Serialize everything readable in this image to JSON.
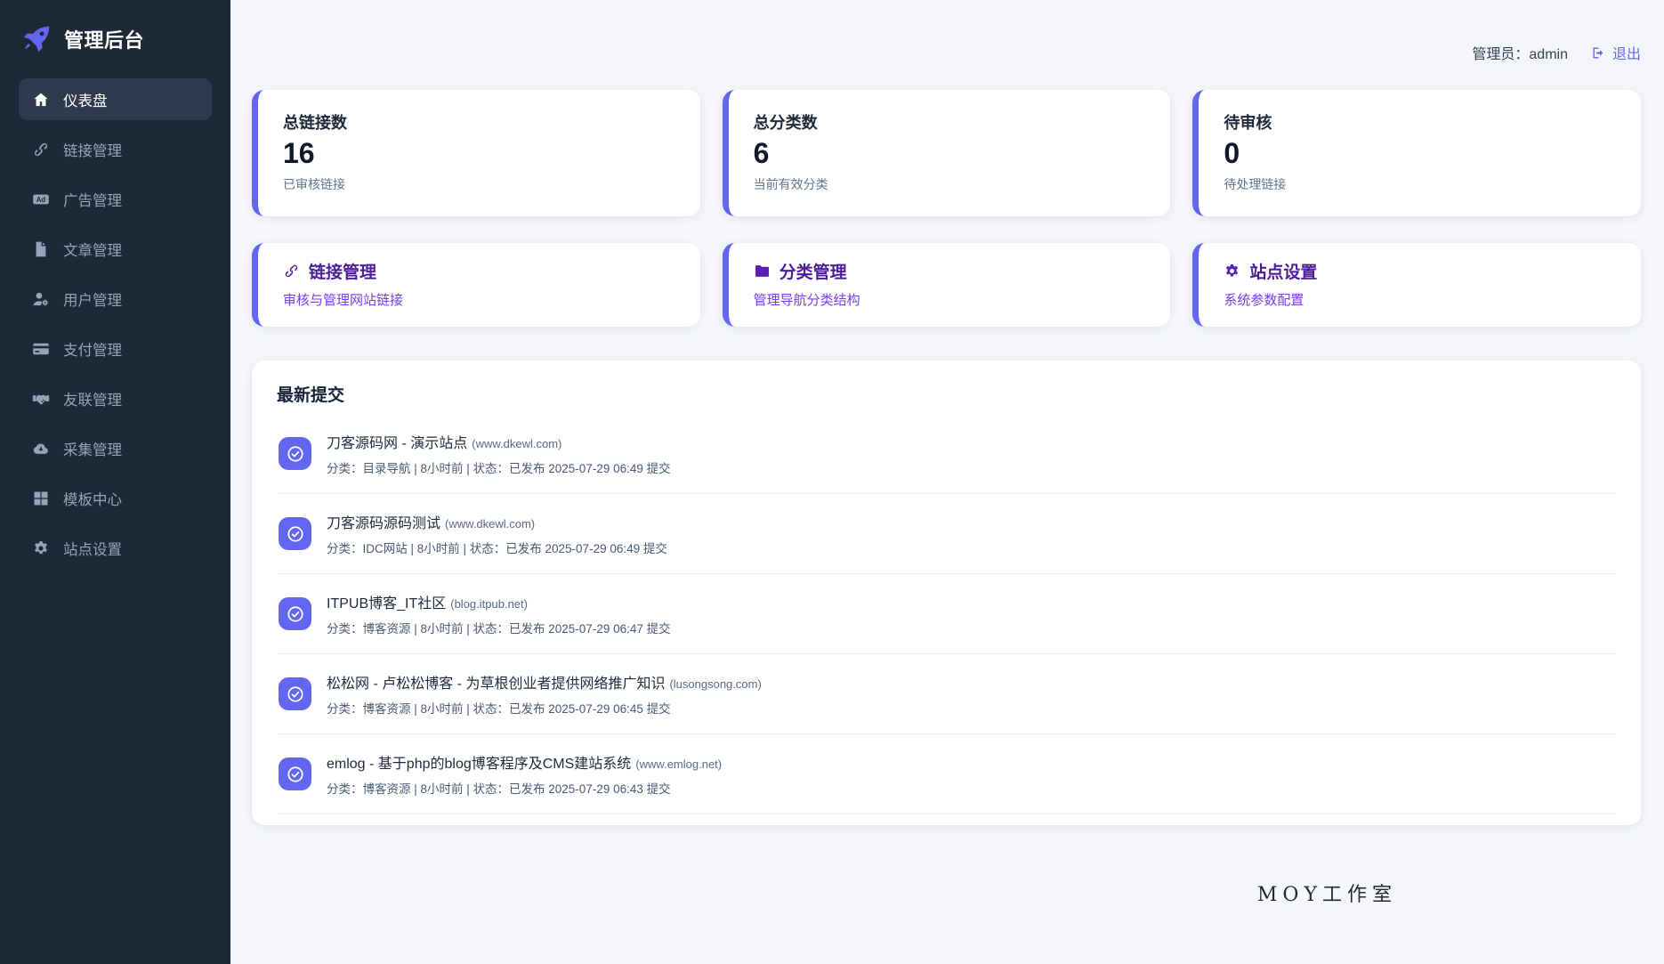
{
  "app": {
    "title": "管理后台",
    "logo_icon": "rocket"
  },
  "header": {
    "admin_label": "管理员：",
    "admin_name": "admin",
    "logout_label": "退出",
    "logout_icon": "logout"
  },
  "sidebar": {
    "items": [
      {
        "label": "仪表盘",
        "icon": "home",
        "active": true
      },
      {
        "label": "链接管理",
        "icon": "link",
        "active": false
      },
      {
        "label": "广告管理",
        "icon": "ad",
        "active": false
      },
      {
        "label": "文章管理",
        "icon": "file",
        "active": false
      },
      {
        "label": "用户管理",
        "icon": "user",
        "active": false
      },
      {
        "label": "支付管理",
        "icon": "card",
        "active": false
      },
      {
        "label": "友联管理",
        "icon": "handshake",
        "active": false
      },
      {
        "label": "采集管理",
        "icon": "cloud",
        "active": false
      },
      {
        "label": "模板中心",
        "icon": "grid",
        "active": false
      },
      {
        "label": "站点设置",
        "icon": "gear",
        "active": false
      }
    ]
  },
  "stats": [
    {
      "title": "总链接数",
      "value": "16",
      "caption": "已审核链接"
    },
    {
      "title": "总分类数",
      "value": "6",
      "caption": "当前有效分类"
    },
    {
      "title": "待审核",
      "value": "0",
      "caption": "待处理链接"
    }
  ],
  "actions": [
    {
      "icon": "link",
      "title": "链接管理",
      "subtitle": "审核与管理网站链接"
    },
    {
      "icon": "folder",
      "title": "分类管理",
      "subtitle": "管理导航分类结构"
    },
    {
      "icon": "gear",
      "title": "站点设置",
      "subtitle": "系统参数配置"
    }
  ],
  "submissions": {
    "title": "最新提交",
    "item_icon": "check-circle",
    "items": [
      {
        "name": "刀客源码网 - 演示站点",
        "url": "(www.dkewl.com)",
        "meta": "分类：目录导航 | 8小时前 | 状态：已发布 2025-07-29 06:49 提交"
      },
      {
        "name": "刀客源码源码测试",
        "url": "(www.dkewl.com)",
        "meta": "分类：IDC网站 | 8小时前 | 状态：已发布 2025-07-29 06:49 提交"
      },
      {
        "name": "ITPUB博客_IT社区",
        "url": "(blog.itpub.net)",
        "meta": "分类：博客资源 | 8小时前 | 状态：已发布 2025-07-29 06:47 提交"
      },
      {
        "name": "松松网 - 卢松松博客 - 为草根创业者提供网络推广知识",
        "url": "(lusongsong.com)",
        "meta": "分类：博客资源 | 8小时前 | 状态：已发布 2025-07-29 06:45 提交"
      },
      {
        "name": "emlog - 基于php的blog博客程序及CMS建站系统",
        "url": "(www.emlog.net)",
        "meta": "分类：博客资源 | 8小时前 | 状态：已发布 2025-07-29 06:43 提交"
      }
    ]
  },
  "footer": {
    "text": "MOY工作室"
  },
  "colors": {
    "accent": "#6366f1",
    "sidebar_bg": "#1e2938",
    "action_title": "#4c1d95",
    "action_subtitle": "#7c3aed"
  }
}
